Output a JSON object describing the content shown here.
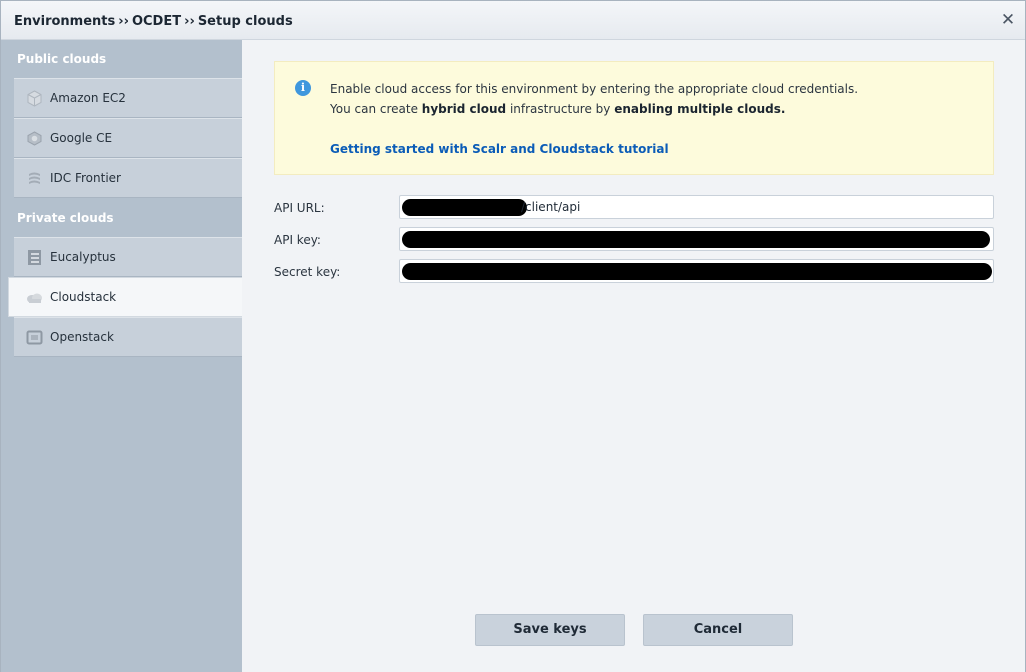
{
  "header": {
    "breadcrumb": [
      "Environments",
      "OCDET",
      "Setup clouds"
    ],
    "separator": "››",
    "close_icon": "close-icon"
  },
  "sidebar": {
    "public_title": "Public clouds",
    "private_title": "Private clouds",
    "public_items": [
      {
        "label": "Amazon EC2",
        "icon": "amazon-ec2-icon"
      },
      {
        "label": "Google CE",
        "icon": "google-ce-icon"
      },
      {
        "label": "IDC Frontier",
        "icon": "idc-frontier-icon"
      }
    ],
    "private_items": [
      {
        "label": "Eucalyptus",
        "icon": "eucalyptus-icon"
      },
      {
        "label": "Cloudstack",
        "icon": "cloudstack-icon",
        "selected": true
      },
      {
        "label": "Openstack",
        "icon": "openstack-icon"
      }
    ]
  },
  "notice": {
    "line1": "Enable cloud access for this environment by entering the appropriate cloud credentials.",
    "line2_prefix": "You can create ",
    "line2_bold1": "hybrid cloud",
    "line2_middle": " infrastructure by ",
    "line2_bold2": "enabling multiple clouds.",
    "link": "Getting started with Scalr and Cloudstack tutorial",
    "icon": "info-icon"
  },
  "form": {
    "api_url_label": "API URL:",
    "api_url_visible_suffix": "/client/api",
    "api_key_label": "API key:",
    "secret_key_label": "Secret key:"
  },
  "buttons": {
    "save": "Save keys",
    "cancel": "Cancel"
  },
  "colors": {
    "sidebar_bg": "#b3c0cd",
    "notice_bg": "#fdfbdc",
    "link": "#0b5cb7",
    "info": "#3f97dd"
  }
}
